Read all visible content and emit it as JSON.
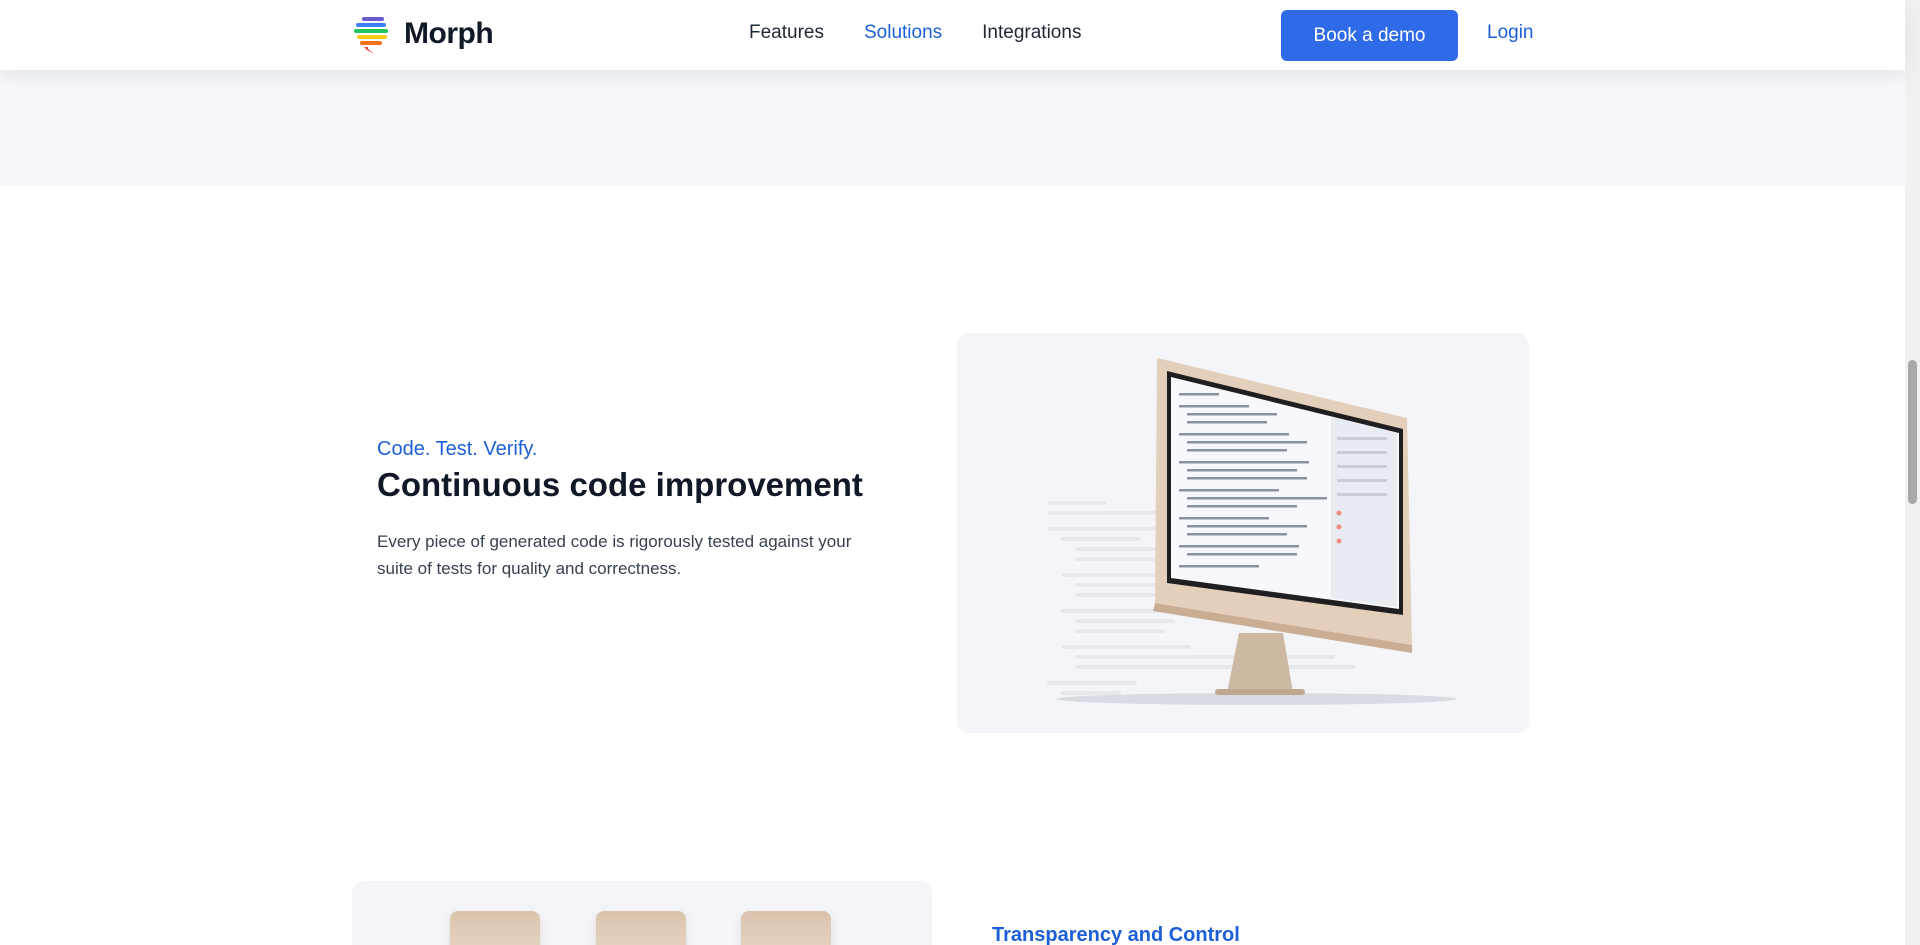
{
  "brand": {
    "name": "Morph",
    "logo_icon": "rainbow-tornado-icon"
  },
  "nav": {
    "items": [
      {
        "label": "Features",
        "active": false
      },
      {
        "label": "Solutions",
        "active": true
      },
      {
        "label": "Integrations",
        "active": false
      }
    ],
    "demo_button": "Book a demo",
    "login": "Login"
  },
  "feature": {
    "eyebrow": "Code. Test. Verify.",
    "title": "Continuous code improvement",
    "description": "Every piece of generated code is rigorously tested against your suite of tests for quality and correctness.",
    "image_icon": "desktop-monitor-with-code-icon"
  },
  "next_section": {
    "eyebrow": "Transparency and Control"
  },
  "colors": {
    "accent": "#2f6be8",
    "link": "#1d5fd6",
    "heading": "#111827",
    "band": "#f6f7fb"
  }
}
